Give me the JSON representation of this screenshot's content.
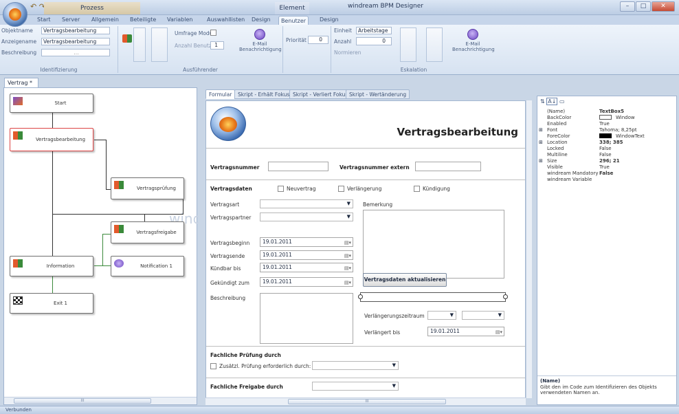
{
  "app": {
    "title": "windream BPM Designer",
    "ctx_prozess": "Prozess",
    "ctx_element": "Element",
    "qat": "↶ ↷"
  },
  "window_controls": {
    "minimize": "–",
    "maximize": "□",
    "close": "✕"
  },
  "tabs": [
    "Start",
    "Server",
    "Allgemein",
    "Beteiligte",
    "Variablen",
    "Auswahllisten",
    "Design",
    "Benutzer",
    "Design"
  ],
  "ribbon": {
    "ident": {
      "objektname_label": "Objektname",
      "objektname_value": "Vertragsbearbeitung",
      "anzeigename_label": "Anzeigename",
      "anzeigename_value": "Vertragsbearbeitung",
      "beschreibung_label": "Beschreibung",
      "beschreibung_value": "...",
      "group_label": "Identifizierung"
    },
    "ausf": {
      "umfrage_label": "Umfrage Modus",
      "anzahl_label": "Anzahl Benutzer",
      "anzahl_value": "1",
      "email_label": "E-Mail Benachrichtigung",
      "group_label": "Ausführender"
    },
    "prio": {
      "label": "Priorität",
      "value": "0"
    },
    "esk": {
      "einheit_label": "Einheit",
      "einheit_value": "Arbeitstage",
      "anzahl_label": "Anzahl",
      "anzahl_value": "0",
      "normieren_label": "Normieren",
      "email_label": "E-Mail Benachrichtigung",
      "group_label": "Eskalation"
    }
  },
  "doc_tab": "Vertrag *",
  "diagram": {
    "nodes": [
      {
        "label": "Start"
      },
      {
        "label": "Vertragsbearbeitung"
      },
      {
        "label": "Vertragsprüfung"
      },
      {
        "label": "Vertragsfreigabe"
      },
      {
        "label": "Information"
      },
      {
        "label": "Notification 1"
      },
      {
        "label": "Exit 1"
      }
    ],
    "watermark": "windr"
  },
  "form_tabs": [
    "Formular",
    "Skript - Erhält Fokus",
    "Skript - Verliert Fokus",
    "Skript - Wertänderung"
  ],
  "form": {
    "title": "Vertragsbearbeitung",
    "vertragsnummer_label": "Vertragsnummer",
    "vertragsnummer_extern_label": "Vertragsnummer extern",
    "vertragsdaten_label": "Vertragsdaten",
    "chk_neuvertrag": "Neuvertrag",
    "chk_verlaengerung": "Verlängerung",
    "chk_kuendigung": "Kündigung",
    "vertragsart_label": "Vertragsart",
    "vertragspartner_label": "Vertragspartner",
    "bemerkung_label": "Bemerkung",
    "beginn_label": "Vertragsbeginn",
    "beginn_value": "19.01.2011",
    "ende_label": "Vertragsende",
    "ende_value": "19.01.2011",
    "kuendbar_label": "Kündbar bis",
    "kuendbar_value": "19.01.2011",
    "gekuendigt_label": "Gekündigt zum",
    "gekuendigt_value": "19.01.2011",
    "update_button": "Vertragsdaten aktualisieren",
    "beschreibung_label": "Beschreibung",
    "vzeitraum_label": "Verlängerungszeitraum",
    "verlaengert_label": "Verlängert bis",
    "verlaengert_value": "19.01.2011",
    "pruefung_label": "Fachliche Prüfung durch",
    "zusaetzl_label": "Zusätzl. Prüfung erforderlich durch:",
    "freigabe_label": "Fachliche Freigabe durch"
  },
  "properties": {
    "rows": [
      {
        "key": "(Name)",
        "value": "TextBox5",
        "bold": true,
        "exp": ""
      },
      {
        "key": "BackColor",
        "value": "Window",
        "bold": false,
        "exp": "",
        "swatch": "#ffffff"
      },
      {
        "key": "Enabled",
        "value": "True",
        "bold": false,
        "exp": ""
      },
      {
        "key": "Font",
        "value": "Tahoma; 8,25pt",
        "bold": false,
        "exp": "⊞"
      },
      {
        "key": "ForeColor",
        "value": "WindowText",
        "bold": false,
        "exp": "",
        "swatch": "#000000"
      },
      {
        "key": "Location",
        "value": "338; 385",
        "bold": true,
        "exp": "⊞"
      },
      {
        "key": "Locked",
        "value": "False",
        "bold": false,
        "exp": ""
      },
      {
        "key": "Multiline",
        "value": "False",
        "bold": false,
        "exp": ""
      },
      {
        "key": "Size",
        "value": "296; 21",
        "bold": true,
        "exp": "⊞"
      },
      {
        "key": "Visible",
        "value": "True",
        "bold": false,
        "exp": ""
      },
      {
        "key": "windream Mandatory",
        "value": "False",
        "bold": true,
        "exp": ""
      },
      {
        "key": "windream Variable",
        "value": "",
        "bold": false,
        "exp": ""
      }
    ],
    "help_title": "(Name)",
    "help_text": "Gibt den im Code zum Identifizieren des Objekts verwendeten Namen an."
  },
  "status": "Verbunden",
  "scroll_grip": "III",
  "colors": {
    "accent": "#3e6aa8",
    "selected_border": "#dd4444",
    "connector_green": "#3b8a3b"
  }
}
